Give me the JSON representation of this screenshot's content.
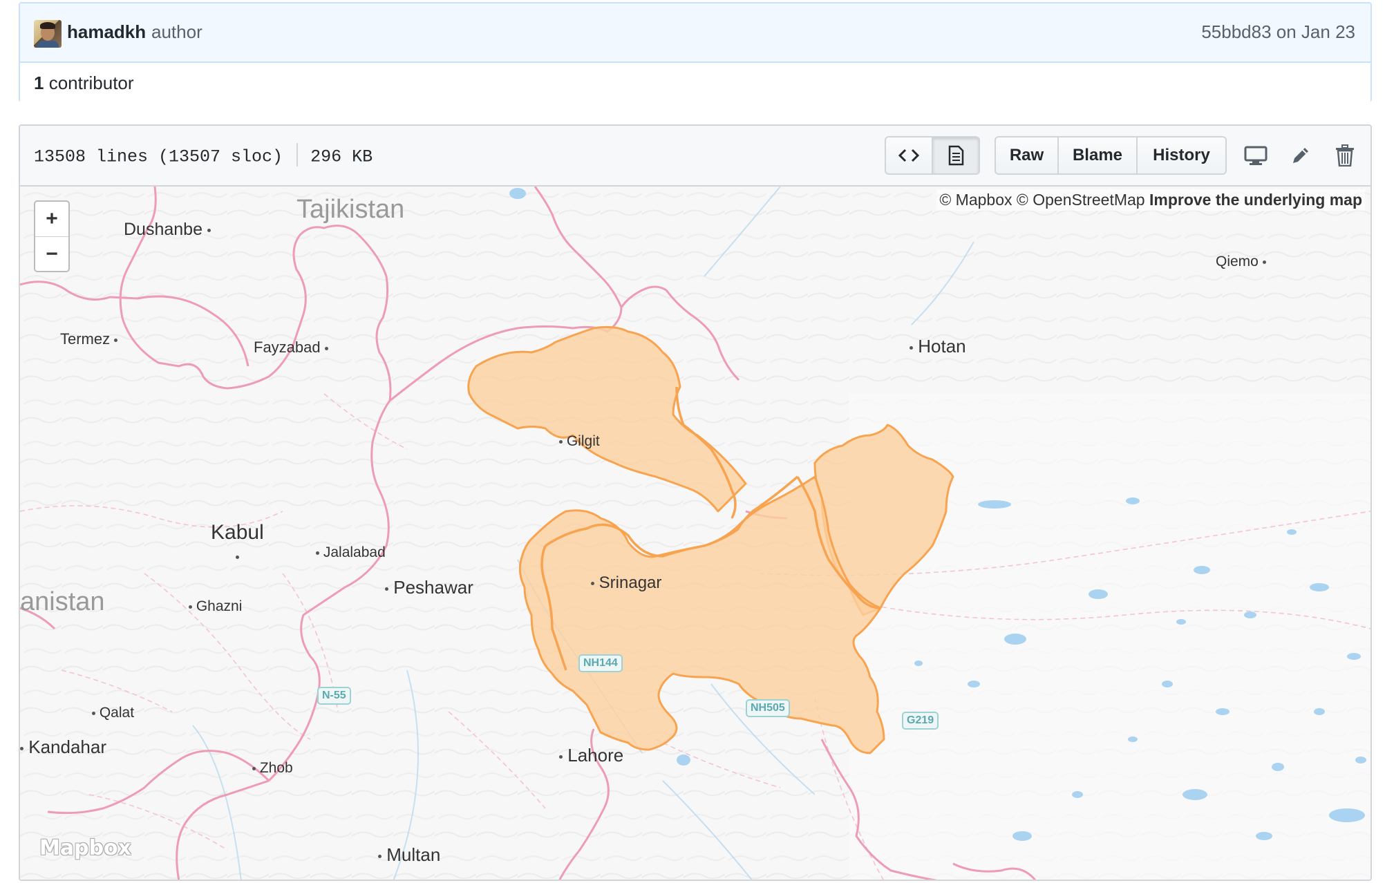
{
  "commit": {
    "author": "hamadkh",
    "role": "author",
    "sha_date": "55bbd83 on Jan 23",
    "contributor_count": "1",
    "contributor_label": "contributor"
  },
  "file": {
    "lines": "13508 lines (13507 sloc)",
    "size": "296 KB",
    "buttons": {
      "raw": "Raw",
      "blame": "Blame",
      "history": "History"
    }
  },
  "map": {
    "attribution_mapbox": "© Mapbox",
    "attribution_osm": "© OpenStreetMap",
    "attribution_improve": "Improve the underlying map",
    "logo": "Mapbox",
    "zoom_in": "+",
    "zoom_out": "−",
    "places": {
      "tajikistan": "Tajikistan",
      "dushanbe": "Dushanbe",
      "termez": "Termez",
      "fayzabad": "Fayzabad",
      "qiemo": "Qiemo",
      "hotan": "Hotan",
      "gilgit": "Gilgit",
      "kabul": "Kabul",
      "jalalabad": "Jalalabad",
      "peshawar": "Peshawar",
      "srinagar": "Srinagar",
      "afghanistan": "anistan",
      "ghazni": "Ghazni",
      "qalat": "Qalat",
      "kandahar": "Kandahar",
      "zhob": "Zhob",
      "lahore": "Lahore",
      "multan": "Multan"
    },
    "roads": {
      "nh144": "NH144",
      "n55": "N-55",
      "nh505": "NH505",
      "g219": "G219"
    },
    "colors": {
      "border": "#ee9bb5",
      "highlight_fill": "#fdcf9e",
      "highlight_stroke": "#f7a34f",
      "water": "#a9d3f0"
    }
  }
}
